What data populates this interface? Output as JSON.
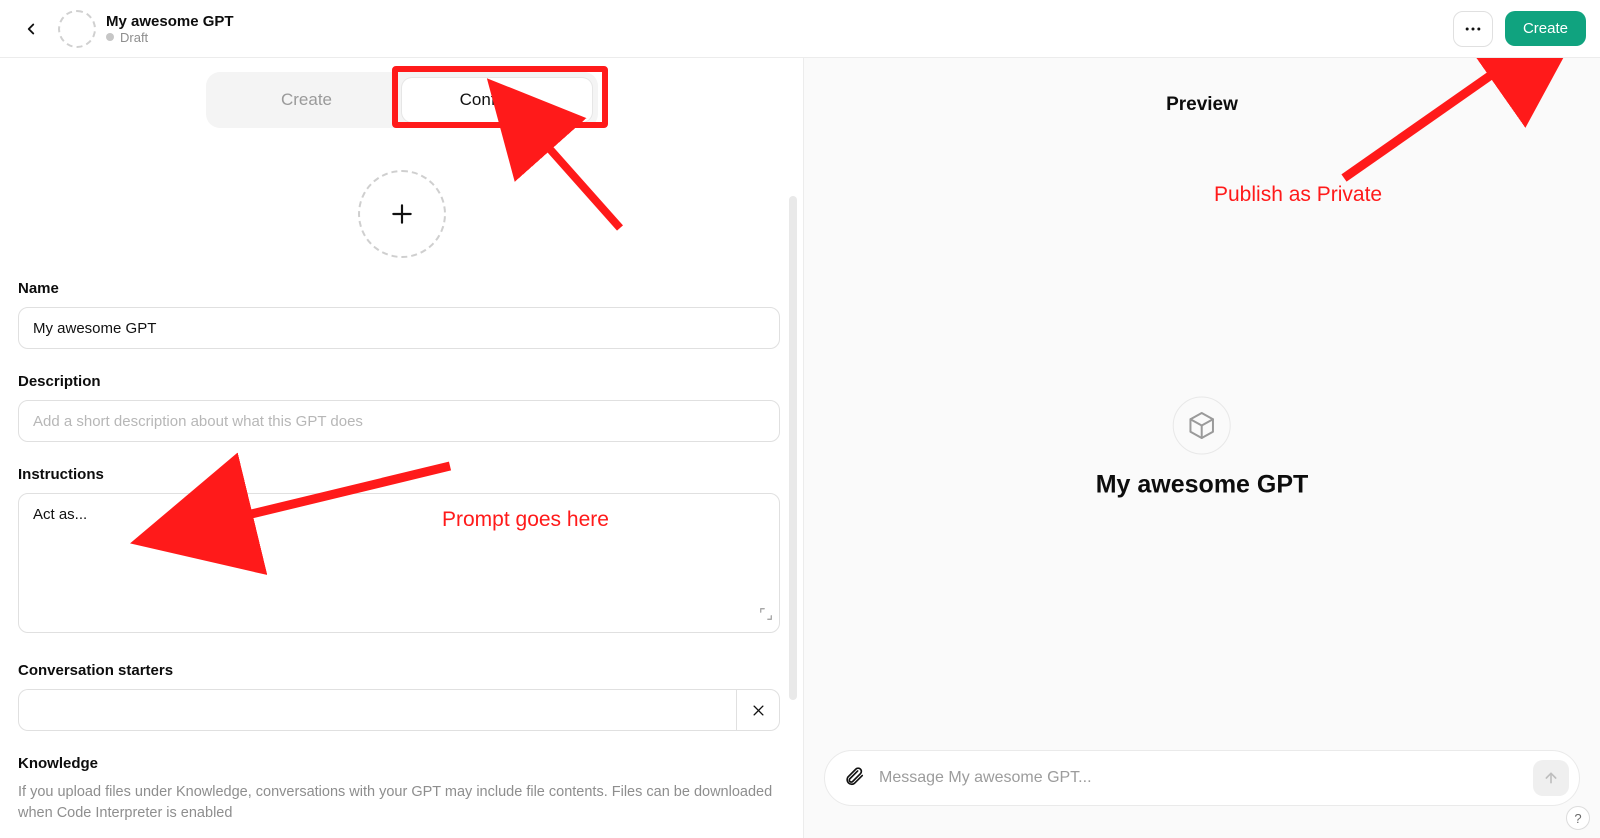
{
  "header": {
    "title": "My awesome GPT",
    "status": "Draft",
    "more_label": "...",
    "create_label": "Create"
  },
  "tabs": {
    "create": "Create",
    "configure": "Configure",
    "active": "configure"
  },
  "form": {
    "name_label": "Name",
    "name_value": "My awesome GPT",
    "description_label": "Description",
    "description_placeholder": "Add a short description about what this GPT does",
    "instructions_label": "Instructions",
    "instructions_value": "Act as...",
    "starters_label": "Conversation starters",
    "starter_value": "",
    "knowledge_label": "Knowledge",
    "knowledge_help": "If you upload files under Knowledge, conversations with your GPT may include file contents. Files can be downloaded when Code Interpreter is enabled"
  },
  "preview": {
    "heading": "Preview",
    "gpt_name": "My awesome GPT",
    "compose_placeholder": "Message My awesome GPT..."
  },
  "annotations": {
    "prompt": "Prompt goes here",
    "publish": "Publish as Private"
  }
}
